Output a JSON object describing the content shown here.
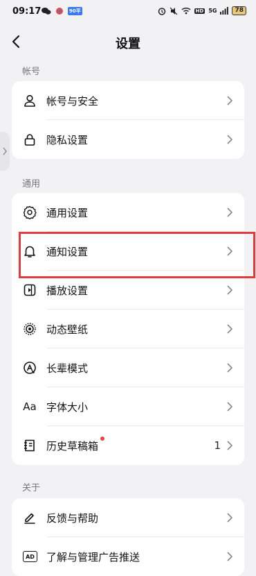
{
  "status_bar": {
    "time": "09:17",
    "signal_text": "5G",
    "hd": "HD",
    "battery": "78",
    "chip": "90平"
  },
  "nav": {
    "title": "设置"
  },
  "sections": [
    {
      "label": "帐号",
      "items": [
        {
          "label": "帐号与安全",
          "icon": "person-icon"
        },
        {
          "label": "隐私设置",
          "icon": "lock-icon"
        }
      ]
    },
    {
      "label": "通用",
      "items": [
        {
          "label": "通用设置",
          "icon": "gear-icon"
        },
        {
          "label": "通知设置",
          "icon": "bell-icon"
        },
        {
          "label": "播放设置",
          "icon": "play-settings-icon"
        },
        {
          "label": "动态壁纸",
          "icon": "dynamic-wallpaper-icon"
        },
        {
          "label": "长辈模式",
          "icon": "elder-mode-icon"
        },
        {
          "label": "字体大小",
          "icon": "font-size-icon",
          "icon_text": "Aa"
        },
        {
          "label": "历史草稿箱",
          "icon": "drafts-icon",
          "value": "1"
        }
      ]
    },
    {
      "label": "关于",
      "items": [
        {
          "label": "反馈与帮助",
          "icon": "feedback-icon"
        },
        {
          "label": "了解与管理广告推送",
          "icon": "ad-icon",
          "icon_text": "AD"
        }
      ]
    }
  ],
  "colors": {
    "highlight": "#e23b3b",
    "badge": "#f0413a",
    "background": "#f2f2f4"
  }
}
